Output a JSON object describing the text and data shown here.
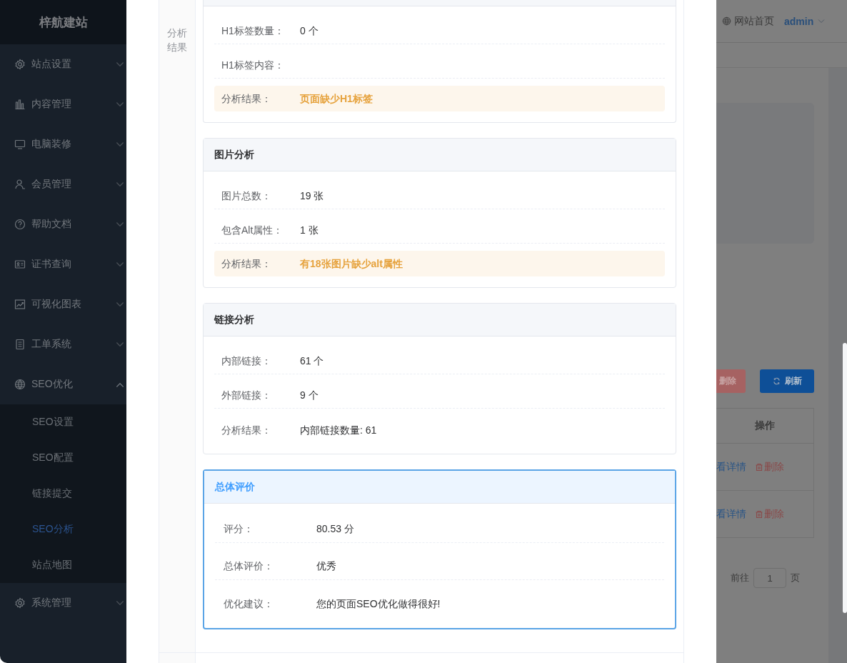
{
  "sidebar": {
    "logo": "梓航建站",
    "items": [
      {
        "label": "站点设置",
        "expanded": false
      },
      {
        "label": "内容管理",
        "expanded": false
      },
      {
        "label": "电脑装修",
        "expanded": false
      },
      {
        "label": "会员管理",
        "expanded": false
      },
      {
        "label": "帮助文档",
        "expanded": false
      },
      {
        "label": "证书查询",
        "expanded": false
      },
      {
        "label": "可视化图表",
        "expanded": false
      },
      {
        "label": "工单系统",
        "expanded": false
      },
      {
        "label": "SEO优化",
        "expanded": true,
        "children": [
          {
            "label": "SEO设置",
            "selected": false
          },
          {
            "label": "SEO配置",
            "selected": false
          },
          {
            "label": "链接提交",
            "selected": false
          },
          {
            "label": "SEO分析",
            "selected": true
          },
          {
            "label": "站点地图",
            "selected": false
          }
        ]
      },
      {
        "label": "系统管理",
        "expanded": false
      }
    ]
  },
  "dialog": {
    "section_label": "分析结果",
    "cards": [
      {
        "kind": "normal",
        "rows": [
          {
            "kind": "normal",
            "label": "H1标签数量：",
            "value": "0 个"
          },
          {
            "kind": "normal",
            "label": "H1标签内容："
          },
          {
            "kind": "result",
            "label": "分析结果：",
            "value": "页面缺少H1标签"
          }
        ]
      },
      {
        "kind": "normal",
        "title": "图片分析",
        "rows": [
          {
            "kind": "normal",
            "label": "图片总数：",
            "value": "19 张"
          },
          {
            "kind": "normal",
            "label": "包含Alt属性：",
            "value": "1 张"
          },
          {
            "kind": "result",
            "label": "分析结果：",
            "value": "有18张图片缺少alt属性"
          }
        ]
      },
      {
        "kind": "normal",
        "title": "链接分析",
        "rows": [
          {
            "kind": "normal",
            "label": "内部链接：",
            "value": "61 个"
          },
          {
            "kind": "normal",
            "label": "外部链接：",
            "value": "9 个"
          },
          {
            "kind": "normal",
            "label": "分析结果：",
            "value": "内部链接数量: 61"
          }
        ]
      },
      {
        "kind": "summary",
        "title": "总体评价",
        "rows": [
          {
            "kind": "normal",
            "label": "评分：",
            "value": "80.53 分"
          },
          {
            "kind": "normal",
            "label": "总体评价：",
            "value": "优秀"
          },
          {
            "kind": "normal",
            "label": "优化建议：",
            "value": "您的页面SEO优化做得很好!"
          }
        ]
      }
    ]
  },
  "header": {
    "home_link": "网站首页",
    "user": "admin"
  },
  "toolbar": {
    "buttons": [
      {
        "kind": "danger",
        "label": "删除"
      },
      {
        "kind": "primary",
        "label": "刷新"
      }
    ]
  },
  "table": {
    "columns": [
      "操作"
    ],
    "rows": [
      {
        "view": "看详情",
        "delete": "删除"
      },
      {
        "view": "看详情",
        "delete": "删除"
      }
    ]
  },
  "pagination": {
    "goto_label": "前往",
    "page": "1",
    "page_suffix": "页"
  }
}
